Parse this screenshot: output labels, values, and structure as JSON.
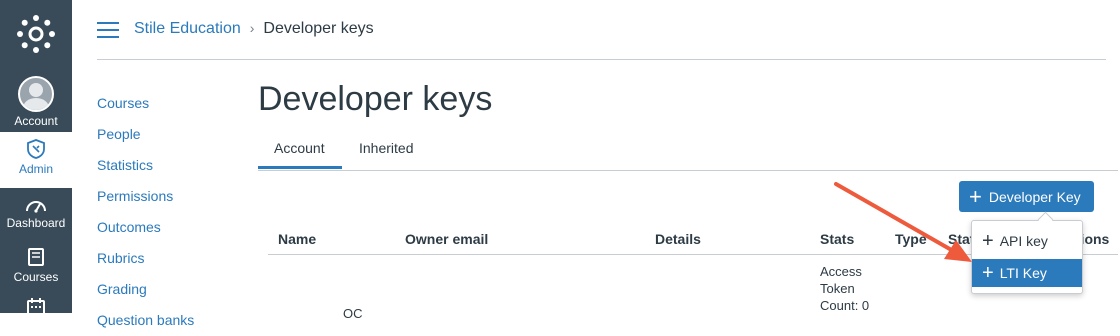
{
  "global_nav": {
    "items": [
      {
        "label": "Account",
        "icon": "avatar-icon"
      },
      {
        "label": "Admin",
        "icon": "shield-icon"
      },
      {
        "label": "Dashboard",
        "icon": "dashboard-icon"
      },
      {
        "label": "Courses",
        "icon": "book-icon"
      },
      {
        "label": "",
        "icon": "calendar-icon"
      }
    ],
    "accent": "#394b58"
  },
  "breadcrumb": {
    "parent": "Stile Education",
    "separator": "›",
    "current": "Developer keys"
  },
  "course_nav": [
    "Courses",
    "People",
    "Statistics",
    "Permissions",
    "Outcomes",
    "Rubrics",
    "Grading",
    "Question banks"
  ],
  "page": {
    "title": "Developer keys",
    "tabs": [
      "Account",
      "Inherited"
    ],
    "active_tab": "Account",
    "add_button": "Developer Key"
  },
  "table": {
    "columns": [
      "Name",
      "Owner email",
      "Details",
      "Stats",
      "Type",
      "State",
      "Actions"
    ],
    "rows": [
      {
        "stats": [
          "Access",
          "Token",
          "Count: 0"
        ],
        "partial": "OC"
      }
    ]
  },
  "menu": {
    "items": [
      "API key",
      "LTI Key"
    ],
    "selected": "LTI Key"
  },
  "colors": {
    "link": "#2b7abc",
    "arrow": "#ee5a3c"
  }
}
